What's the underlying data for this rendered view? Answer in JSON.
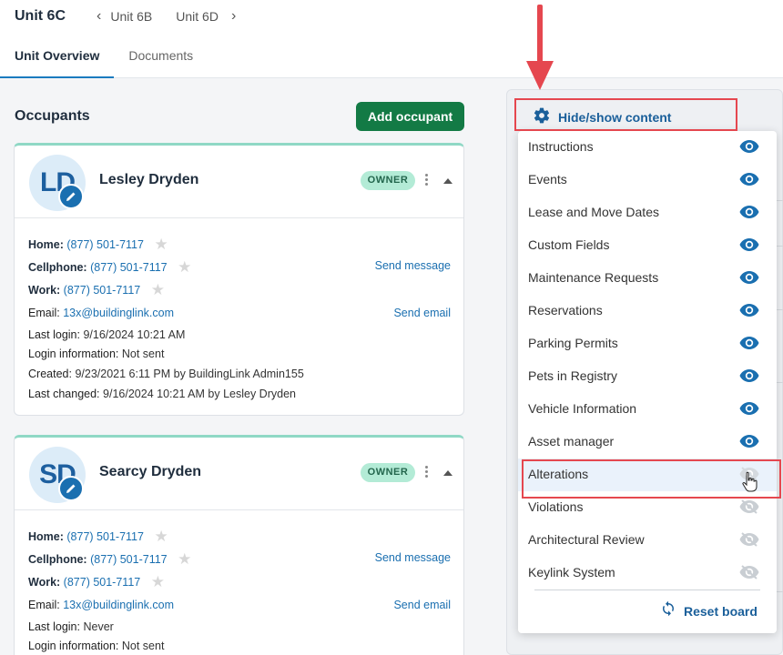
{
  "header": {
    "unit_title": "Unit 6C",
    "prev_unit": "Unit 6B",
    "next_unit": "Unit 6D",
    "tabs": [
      {
        "label": "Unit Overview",
        "active": true
      },
      {
        "label": "Documents",
        "active": false
      }
    ]
  },
  "occupants": {
    "title": "Occupants",
    "add_button": "Add occupant",
    "cards": [
      {
        "initials": "LD",
        "name": "Lesley Dryden",
        "badge": "OWNER",
        "home_label": "Home:",
        "home": "(877) 501-7117",
        "cell_label": "Cellphone:",
        "cell": "(877) 501-7117",
        "work_label": "Work:",
        "work": "(877) 501-7117",
        "send_message": "Send message",
        "email_label": "Email:",
        "email": "13x@buildinglink.com",
        "send_email": "Send email",
        "last_login_label": "Last login:",
        "last_login": "9/16/2024 10:21 AM",
        "login_info_label": "Login information:",
        "login_info": "Not sent",
        "created_label": "Created:",
        "created": "9/23/2021 6:11 PM by BuildingLink Admin155",
        "last_changed_label": "Last changed:",
        "last_changed": "9/16/2024 10:21 AM by Lesley Dryden"
      },
      {
        "initials": "SD",
        "name": "Searcy Dryden",
        "badge": "OWNER",
        "home_label": "Home:",
        "home": "(877) 501-7117",
        "cell_label": "Cellphone:",
        "cell": "(877) 501-7117",
        "work_label": "Work:",
        "work": "(877) 501-7117",
        "send_message": "Send message",
        "email_label": "Email:",
        "email": "13x@buildinglink.com",
        "send_email": "Send email",
        "last_login_label": "Last login:",
        "last_login": "Never",
        "login_info_label": "Login information:",
        "login_info": "Not sent"
      }
    ]
  },
  "panel": {
    "hide_show_label": "Hide/show content",
    "items": [
      {
        "label": "Instructions",
        "visible": true
      },
      {
        "label": "Events",
        "visible": true
      },
      {
        "label": "Lease and Move Dates",
        "visible": true
      },
      {
        "label": "Custom Fields",
        "visible": true
      },
      {
        "label": "Maintenance Requests",
        "visible": true
      },
      {
        "label": "Reservations",
        "visible": true
      },
      {
        "label": "Parking Permits",
        "visible": true
      },
      {
        "label": "Pets in Registry",
        "visible": true
      },
      {
        "label": "Vehicle Information",
        "visible": true
      },
      {
        "label": "Asset manager",
        "visible": true
      },
      {
        "label": "Alterations",
        "visible": false,
        "hovered": true
      },
      {
        "label": "Violations",
        "visible": false
      },
      {
        "label": "Architectural Review",
        "visible": false
      },
      {
        "label": "Keylink System",
        "visible": false
      }
    ],
    "reset_label": "Reset board"
  },
  "colors": {
    "primary": "#1a6fb0",
    "add_button": "#137a45",
    "owner_badge": "#b3ebd6",
    "eye_on": "#1a6fb0",
    "eye_off": "#c9ced3",
    "annotation": "#e5474f"
  },
  "icons": [
    "chevron-left-icon",
    "chevron-right-icon",
    "edit-icon",
    "star-icon",
    "kebab-icon",
    "caret-up-icon",
    "gear-icon",
    "eye-icon",
    "eye-off-icon",
    "refresh-icon",
    "pointer-cursor-icon",
    "red-arrow-icon"
  ]
}
